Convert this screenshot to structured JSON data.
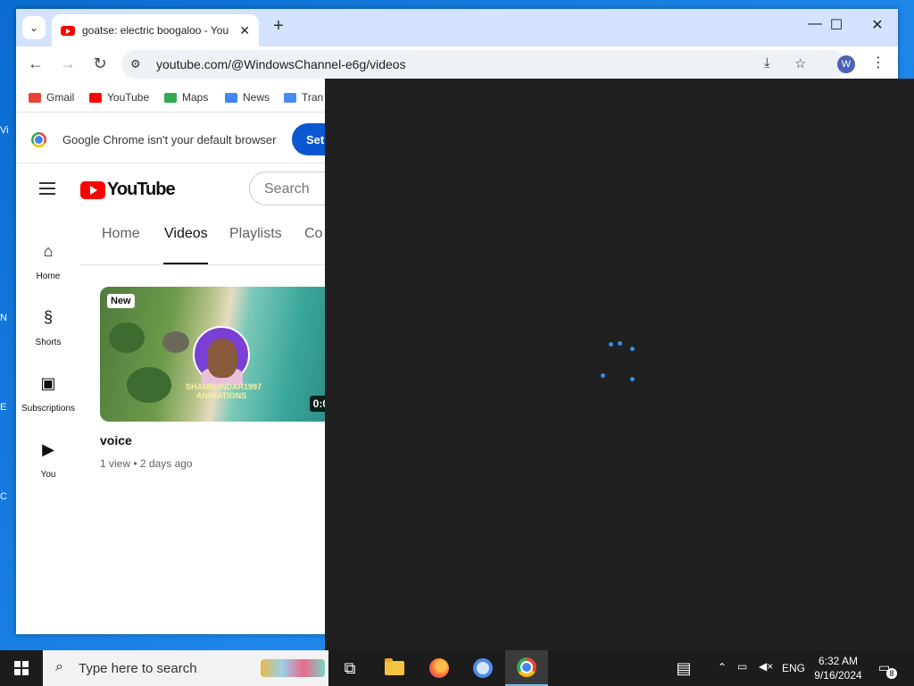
{
  "browser": {
    "tab_title": "goatse: electric boogaloo - You",
    "tab_close": "✕",
    "new_tab": "+",
    "url": "youtube.com/@WindowsChannel-e6g/videos",
    "profile_initial": "W",
    "window_controls": {
      "minimize": "—",
      "maximize": "☐",
      "close": "✕"
    },
    "bookmarks": [
      "Gmail",
      "YouTube",
      "Maps",
      "News",
      "Tran"
    ],
    "infobar_text": "Google Chrome isn't your default browser",
    "infobar_button": "Set"
  },
  "youtube": {
    "logo_text": "YouTube",
    "search_placeholder": "Search",
    "sidebar": [
      {
        "label": "Home",
        "icon": "home-icon"
      },
      {
        "label": "Shorts",
        "icon": "shorts-icon"
      },
      {
        "label": "Subscriptions",
        "icon": "subscriptions-icon"
      },
      {
        "label": "You",
        "icon": "you-icon"
      }
    ],
    "channel_tabs": [
      "Home",
      "Videos",
      "Playlists",
      "Co"
    ],
    "active_tab": "Videos",
    "video": {
      "badge": "New",
      "duration": "0:0",
      "watermark": "SHAMSUNDAR1997 ANIMATIONS",
      "title": "voice",
      "meta": "1 view • 2 days ago"
    }
  },
  "taskbar": {
    "search_text": "Type here to search",
    "language": "ENG",
    "time": "6:32 AM",
    "date": "9/16/2024",
    "notification_count": "8"
  },
  "colors": {
    "overlay": "#202020",
    "spinner": "#3a8ee6",
    "yt_red": "#ff0000",
    "desktop": "#0b6bd0",
    "taskbar": "#1c1c1c"
  }
}
